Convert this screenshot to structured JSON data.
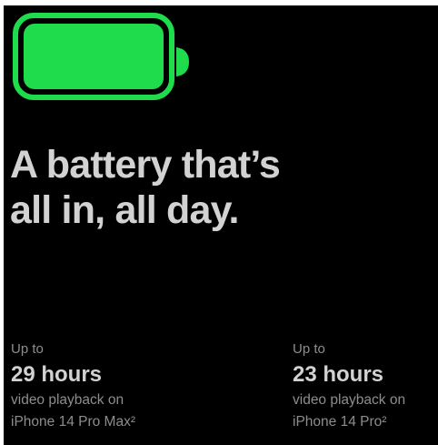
{
  "colors": {
    "background": "#000000",
    "battery_green": "#1fdc4c",
    "headline_text": "#d2d2d2",
    "secondary_text": "#8d8d8d"
  },
  "battery": {
    "icon": "battery-full-icon",
    "charge_level": 1.0
  },
  "headline": {
    "line1": "A battery that’s",
    "line2": "all in, all day."
  },
  "stats": [
    {
      "prefix": "Up to",
      "value": "29 hours",
      "desc_line1": "video playback on",
      "desc_line2": "iPhone 14 Pro Max²"
    },
    {
      "prefix": "Up to",
      "value": "23 hours",
      "desc_line1": "video playback on",
      "desc_line2": "iPhone 14 Pro²"
    }
  ]
}
